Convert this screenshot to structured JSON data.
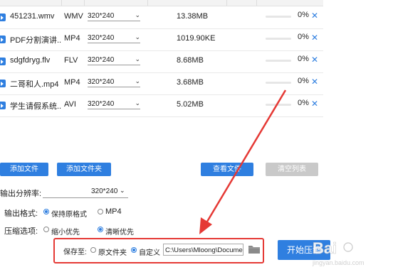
{
  "files": [
    {
      "name": "451231.wmv",
      "format": "WMV",
      "resolution": "320*240",
      "size": "13.38MB",
      "progress": "0%"
    },
    {
      "name": "PDF分割演讲...",
      "format": "MP4",
      "resolution": "320*240",
      "size": "1019.90KE",
      "progress": "0%"
    },
    {
      "name": "sdgfdryg.flv",
      "format": "FLV",
      "resolution": "320*240",
      "size": "8.68MB",
      "progress": "0%"
    },
    {
      "name": "二哥和人.mp4",
      "format": "MP4",
      "resolution": "320*240",
      "size": "3.68MB",
      "progress": "0%"
    },
    {
      "name": "学生请假系统...",
      "format": "AVI",
      "resolution": "320*240",
      "size": "5.02MB",
      "progress": "0%"
    }
  ],
  "toolbar": {
    "add_file": "添加文件",
    "add_folder": "添加文件夹",
    "view_file": "查看文件",
    "clear_list": "清空列表"
  },
  "settings": {
    "output_res_label": "输出分辨率:",
    "output_res_value": "320*240",
    "output_format_label": "输出格式:",
    "format_keep": "保持原格式",
    "format_mp4": "MP4",
    "compress_label": "压缩选项:",
    "compress_small": "缩小优先",
    "compress_clear": "清晰优先",
    "save_label": "保存至:",
    "save_original": "原文件夹",
    "save_custom": "自定义",
    "save_path": "C:\\Users\\Mloong\\Documents",
    "start_button": "开始压缩"
  },
  "watermark": {
    "brand": "Bai",
    "sub": "jingyan.baidu.com"
  },
  "colors": {
    "accent": "#2f7fe0",
    "annotation": "#e53935"
  }
}
